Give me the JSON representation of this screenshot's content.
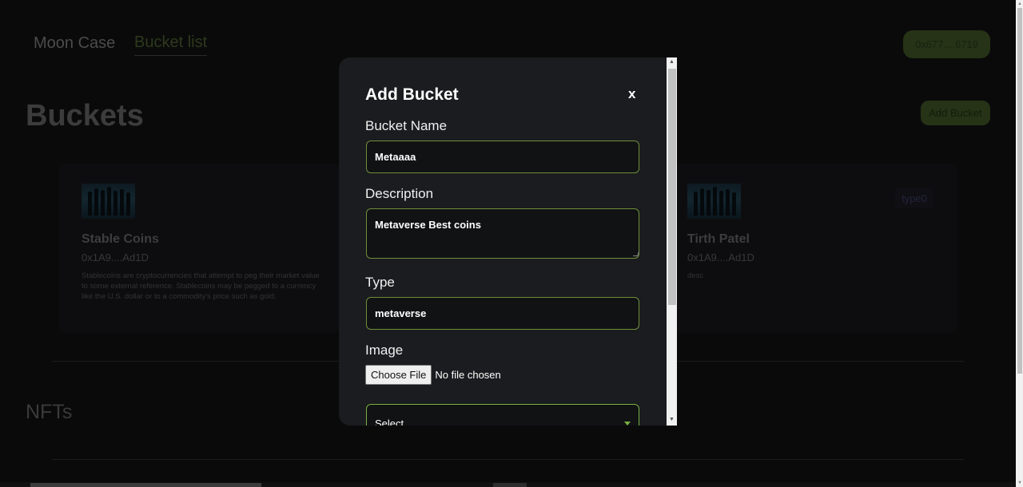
{
  "nav": {
    "brand": "Moon Case",
    "active_link": "Bucket list",
    "wallet_address": "0x677....6719"
  },
  "page": {
    "title": "Buckets",
    "add_bucket_label": "Add Bucket",
    "nfts_title": "NFTs"
  },
  "cards": [
    {
      "title": "Stable Coins",
      "address": "0x1A9....Ad1D",
      "description": "Stablecoins are cryptocurrencies that attempt to peg their market value to some external reference. Stablecoins may be pegged to a currency like the U.S. dollar or to a commodity's price such as gold.",
      "type": ""
    },
    {
      "title": "Tirth Patel",
      "address": "0x1A9....Ad1D",
      "description": "desc",
      "type": "type0"
    }
  ],
  "modal": {
    "title": "Add Bucket",
    "close_label": "x",
    "fields": {
      "name_label": "Bucket Name",
      "name_value": "Metaaaa",
      "description_label": "Description",
      "description_value": "Metaverse Best coins",
      "type_label": "Type",
      "type_value": "metaverse",
      "image_label": "Image",
      "file_button": "Choose File",
      "file_status": "No file chosen",
      "select_value": "Select"
    }
  },
  "colors": {
    "accent_green": "#7ab041",
    "modal_bg": "#1b1c1f",
    "page_bg": "#0a0a0b"
  }
}
